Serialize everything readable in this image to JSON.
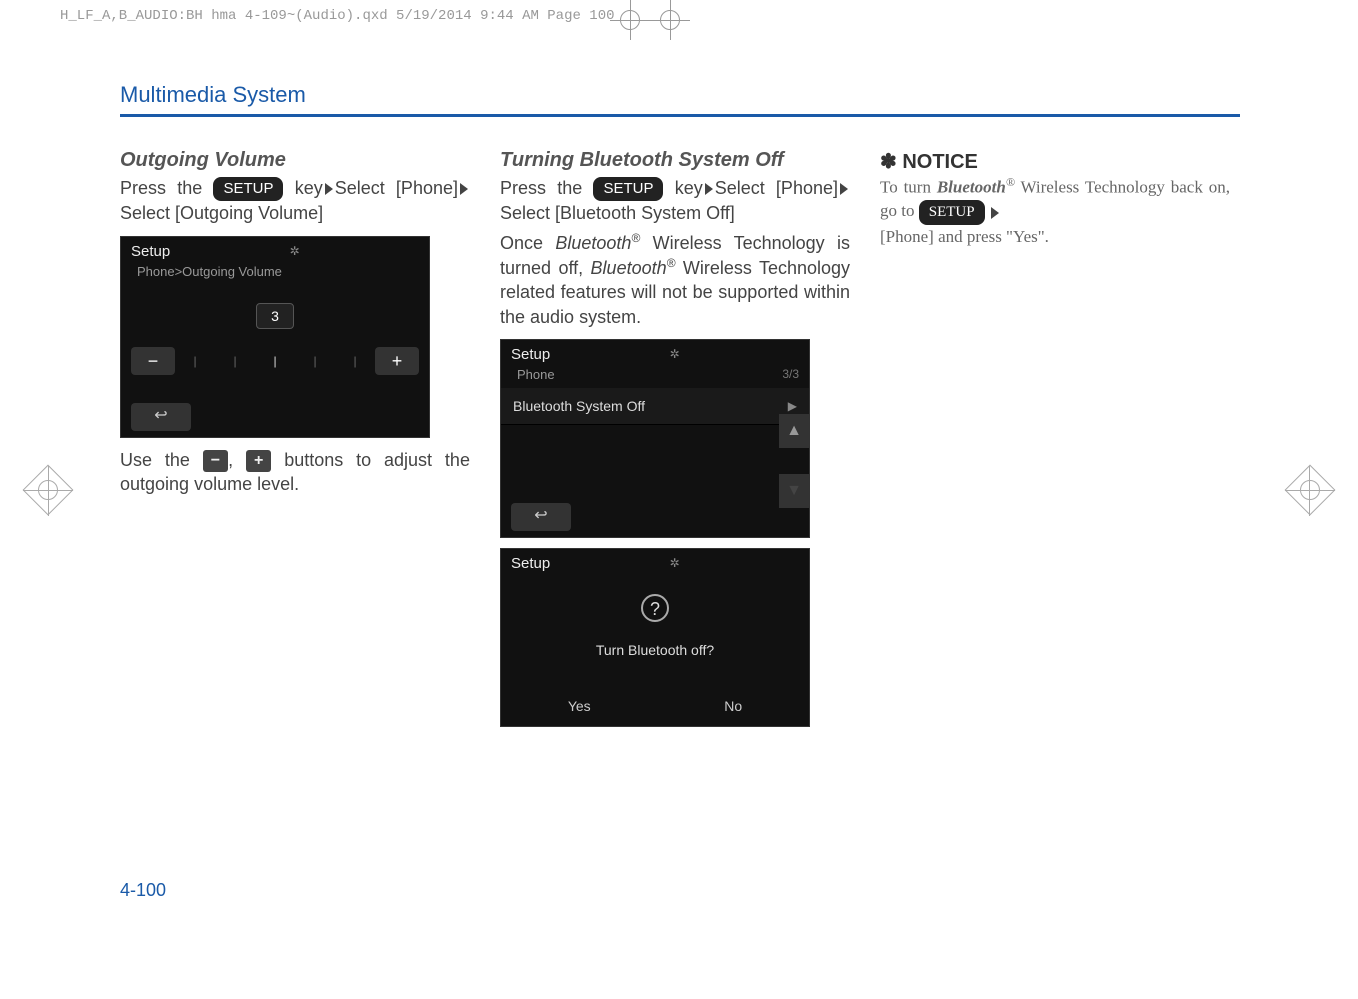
{
  "meta_header": "H_LF_A,B_AUDIO:BH hma 4-109~(Audio).qxd  5/19/2014  9:44 AM  Page 100",
  "section_title": "Multimedia System",
  "col1": {
    "subheading": "Outgoing Volume",
    "press": "Press the ",
    "setup_btn": "SETUP",
    "key_select": " key",
    "select_line": "Select [Phone]",
    "select_line2": "Select [Outgoing Volume]",
    "screenshot": {
      "title": "Setup",
      "breadcrumb": "Phone>Outgoing Volume",
      "value": "3",
      "minus": "−",
      "plus": "+",
      "back": "↩"
    },
    "use_text_pre": "Use the ",
    "minus_btn": "−",
    "plus_btn": "+",
    "use_text_post": " buttons to adjust the outgoing volume level."
  },
  "col2": {
    "subheading": "Turning Bluetooth System Off",
    "press": "Press the ",
    "setup_btn": "SETUP",
    "key": " key",
    "select1": "Select [Phone]",
    "select2": "Select [Bluetooth System Off]",
    "para2_pre": "Once ",
    "bt": "Bluetooth",
    "reg": "®",
    "para2_mid": " Wireless Technology is turned off, ",
    "para2_post": " Wireless Technology related features will not be supported within the audio system.",
    "screenshot1": {
      "title": "Setup",
      "sub": "Phone",
      "count": "3/3",
      "item": "Bluetooth System Off",
      "back": "↩"
    },
    "screenshot2": {
      "title": "Setup",
      "question": "Turn Bluetooth off?",
      "yes": "Yes",
      "no": "No"
    }
  },
  "col3": {
    "notice_star": "✽",
    "notice": "NOTICE",
    "text_pre": "To turn ",
    "bt": "Bluetooth",
    "reg": "®",
    "text_mid": " Wireless Technology back on, go to ",
    "setup_btn": "SETUP",
    "text_post": " [Phone] and press \"Yes\"."
  },
  "page_num": "4-100"
}
